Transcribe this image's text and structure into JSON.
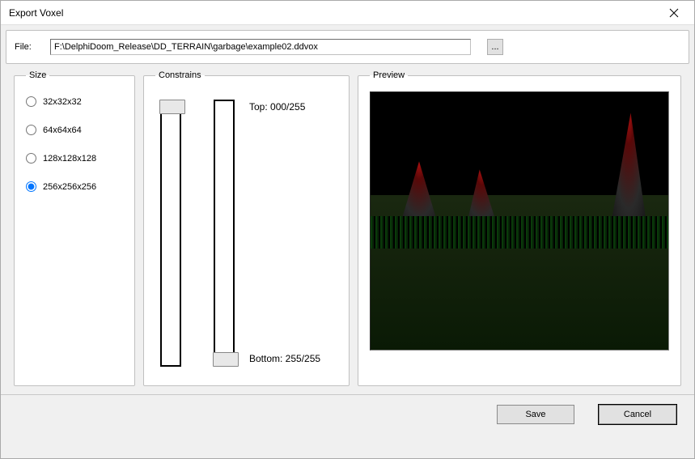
{
  "window": {
    "title": "Export Voxel"
  },
  "file": {
    "label": "File:",
    "value": "F:\\DelphiDoom_Release\\DD_TERRAIN\\garbage\\example02.ddvox",
    "browse_label": "..."
  },
  "size": {
    "legend": "Size",
    "options": [
      {
        "label": "32x32x32",
        "checked": false
      },
      {
        "label": "64x64x64",
        "checked": false
      },
      {
        "label": "128x128x128",
        "checked": false
      },
      {
        "label": "256x256x256",
        "checked": true
      }
    ]
  },
  "constrains": {
    "legend": "Constrains",
    "top_label": "Top: 000/255",
    "bottom_label": "Bottom: 255/255",
    "slider_top_value": 0,
    "slider_bottom_value": 255,
    "max": 255
  },
  "preview": {
    "legend": "Preview"
  },
  "buttons": {
    "save": "Save",
    "cancel": "Cancel"
  }
}
